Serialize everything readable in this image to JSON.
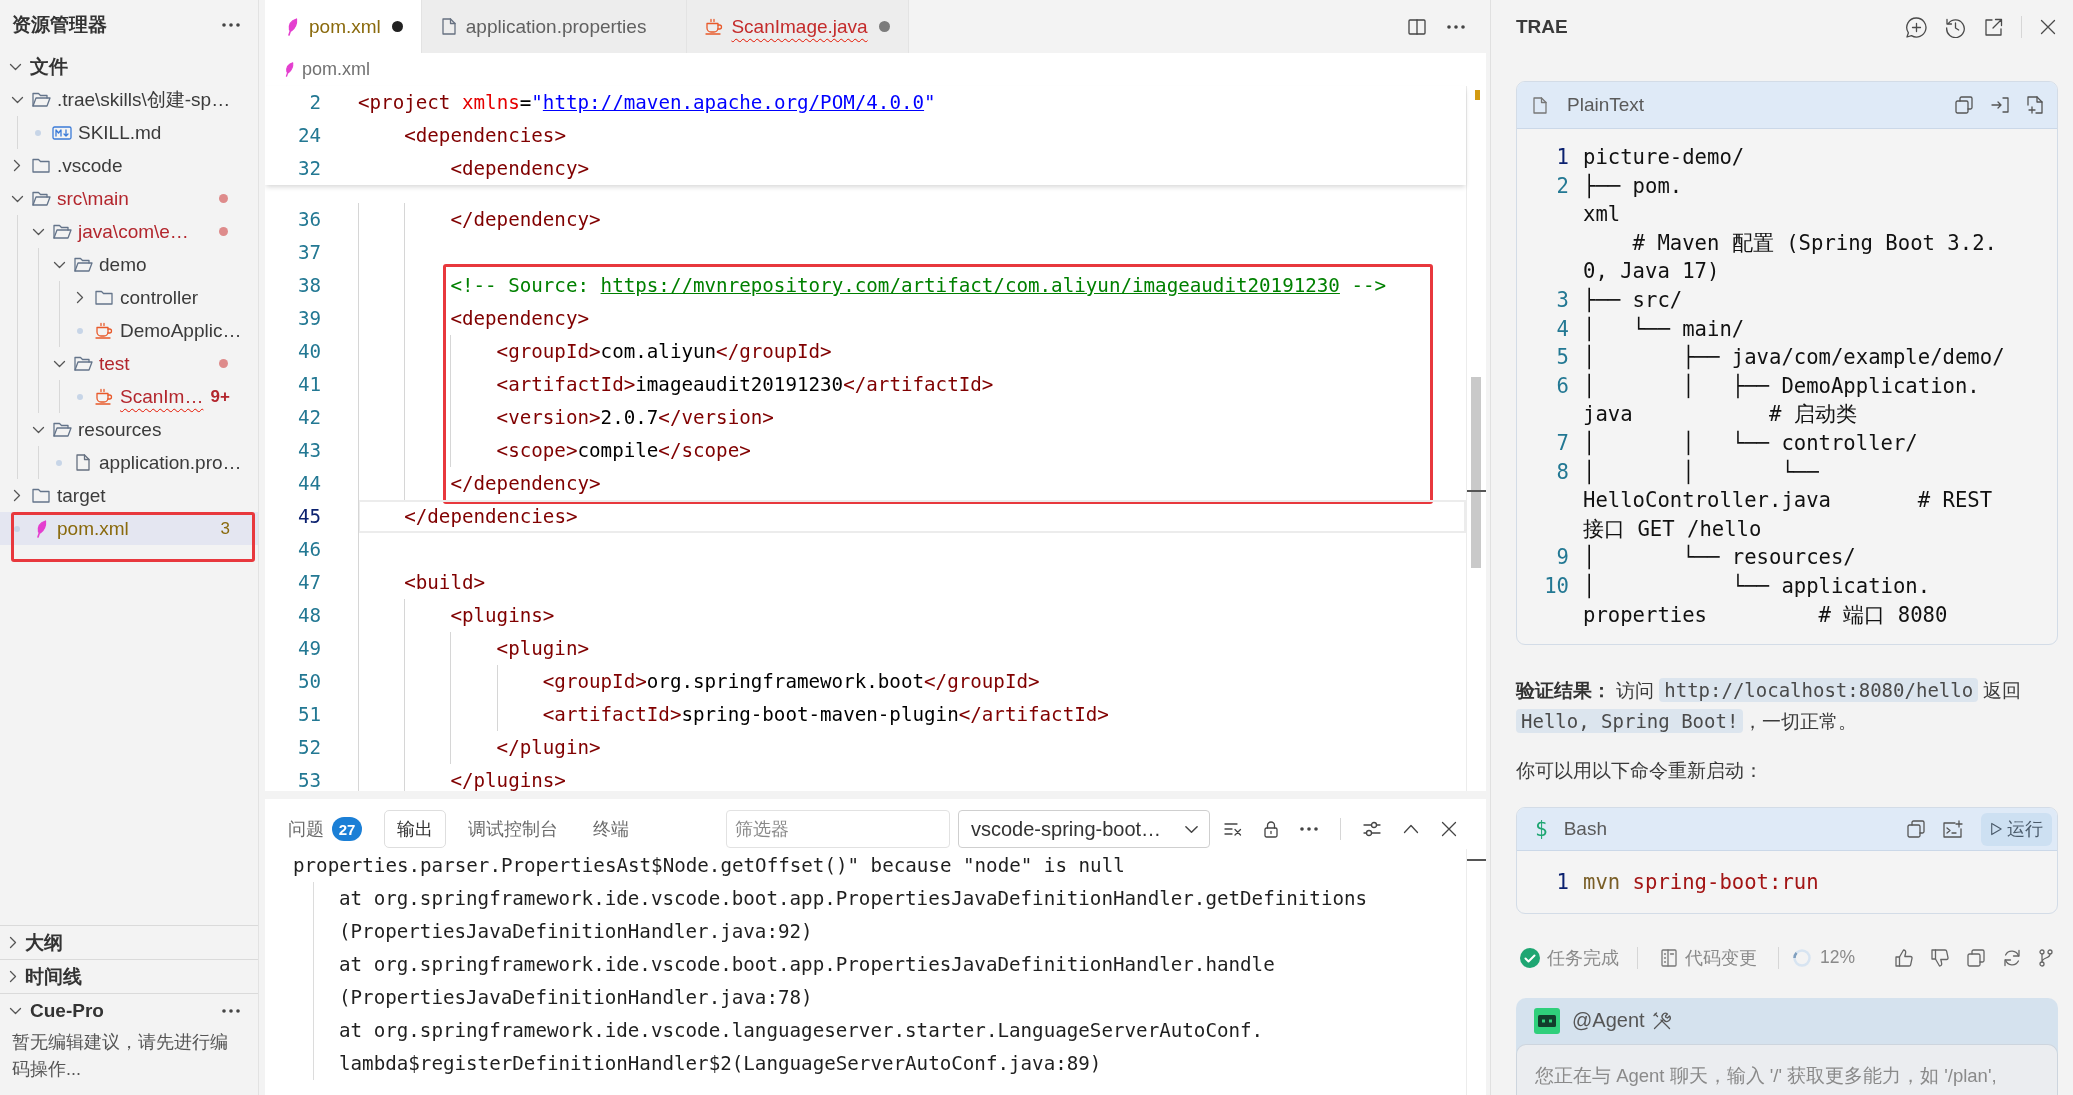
{
  "sidebar": {
    "title": "资源管理器",
    "files": {
      "title": "文件",
      "expanded": true,
      "items": [
        {
          "kind": "folder",
          "label": ".trae\\skills\\创建-sp…",
          "expanded": true,
          "selected": false,
          "errors": false,
          "warnings": false,
          "children": [
            {
              "kind": "md",
              "label": "SKILL.md",
              "selected": false,
              "errors": false,
              "warnings": false
            }
          ]
        },
        {
          "kind": "folder",
          "label": ".vscode",
          "expanded": false,
          "selected": false,
          "errors": false,
          "warnings": false
        },
        {
          "kind": "folder",
          "label": "src\\main",
          "expanded": true,
          "selected": false,
          "errors": true,
          "children": [
            {
              "kind": "folder",
              "label": "java\\com\\e…",
              "expanded": true,
              "selected": false,
              "errors": true,
              "children": [
                {
                  "kind": "folder",
                  "label": "demo",
                  "expanded": true,
                  "selected": false,
                  "errors": false,
                  "warnings": false,
                  "children": [
                    {
                      "kind": "folder",
                      "label": "controller",
                      "expanded": false,
                      "selected": false,
                      "errors": false,
                      "warnings": false
                    },
                    {
                      "kind": "java",
                      "label": "DemoApplic…",
                      "selected": false,
                      "errors": false,
                      "warnings": false
                    }
                  ]
                },
                {
                  "kind": "folder",
                  "label": "test",
                  "expanded": true,
                  "selected": false,
                  "errors": true,
                  "children": [
                    {
                      "kind": "java",
                      "label": "ScanIm…",
                      "selected": false,
                      "errors": true,
                      "badge": "9+"
                    }
                  ]
                }
              ]
            },
            {
              "kind": "folder",
              "label": "resources",
              "expanded": true,
              "selected": false,
              "errors": false,
              "warnings": false,
              "children": [
                {
                  "kind": "file",
                  "label": "application.pro…",
                  "selected": false,
                  "errors": false,
                  "warnings": false
                }
              ]
            }
          ]
        },
        {
          "kind": "folder",
          "label": "target",
          "expanded": false,
          "selected": false,
          "errors": false,
          "warnings": false
        },
        {
          "kind": "xml",
          "label": "pom.xml",
          "selected": true,
          "errors": false,
          "warnings": true,
          "badge": "3",
          "framed": true
        }
      ]
    },
    "sections": [
      {
        "title": "大纲",
        "expanded": false
      },
      {
        "title": "时间线",
        "expanded": false
      },
      {
        "title": "Cue-Pro",
        "expanded": true,
        "text": "暂无编辑建议，请先进行编码操作..."
      }
    ]
  },
  "editor": {
    "tabs": [
      {
        "kind": "xml",
        "label": "pom.xml",
        "selected": true,
        "errors": false,
        "warnings": true,
        "dirty": true
      },
      {
        "kind": "file",
        "label": "application.properties",
        "selected": false,
        "errors": false,
        "warnings": false,
        "dirty": false
      },
      {
        "kind": "java",
        "label": "ScanImage.java",
        "selected": false,
        "errors": true,
        "dirty": true
      }
    ],
    "breadcrumb": {
      "kind": "xml",
      "label": "pom.xml"
    },
    "sticky_lines": [
      {
        "number": "2",
        "tokens": [
          {
            "kind": "tag",
            "text": "<project"
          },
          {
            "kind": "attr",
            "text": " xmlns"
          },
          {
            "kind": "plain",
            "text": "="
          },
          {
            "kind": "string",
            "text": "\""
          },
          {
            "kind": "link",
            "text": "http://maven.apache.org/POM/4.0.0"
          },
          {
            "kind": "string",
            "text": "\""
          }
        ]
      },
      {
        "number": "24",
        "tokens": [
          {
            "kind": "tag",
            "text": "    <dependencies>"
          }
        ]
      },
      {
        "number": "32",
        "tokens": [
          {
            "kind": "tag",
            "text": "        <dependency>"
          }
        ]
      }
    ],
    "blocks": [
      {
        "framed": false,
        "lines": [
          {
            "number": "36",
            "current": false,
            "tokens": [
              {
                "kind": "tag",
                "text": "        </dependency>"
              }
            ]
          },
          {
            "number": "37",
            "current": false
          }
        ]
      },
      {
        "framed": true,
        "lines": [
          {
            "number": "38",
            "current": false,
            "tokens": [
              {
                "kind": "comment",
                "text": "        <!-- Source: "
              },
              {
                "kind": "comment_link",
                "text": "https://mvnrepository.com/artifact/com.aliyun/imageaudit20191230"
              },
              {
                "kind": "comment",
                "text": " -->"
              }
            ]
          },
          {
            "number": "39",
            "current": false,
            "tokens": [
              {
                "kind": "tag",
                "text": "        <dependency>"
              }
            ]
          },
          {
            "number": "40",
            "current": false,
            "tokens": [
              {
                "kind": "tag",
                "text": "            <groupId>"
              },
              {
                "kind": "text",
                "text": "com.aliyun"
              },
              {
                "kind": "tag",
                "text": "</groupId>"
              }
            ]
          },
          {
            "number": "41",
            "current": false,
            "tokens": [
              {
                "kind": "tag",
                "text": "            <artifactId>"
              },
              {
                "kind": "text",
                "text": "imageaudit20191230"
              },
              {
                "kind": "tag",
                "text": "</artifactId>"
              }
            ]
          },
          {
            "number": "42",
            "current": false,
            "tokens": [
              {
                "kind": "tag",
                "text": "            <version>"
              },
              {
                "kind": "text",
                "text": "2.0.7"
              },
              {
                "kind": "tag",
                "text": "</version>"
              }
            ]
          },
          {
            "number": "43",
            "current": false,
            "tokens": [
              {
                "kind": "tag",
                "text": "            <scope>"
              },
              {
                "kind": "text",
                "text": "compile"
              },
              {
                "kind": "tag",
                "text": "</scope>"
              }
            ]
          },
          {
            "number": "44",
            "current": false,
            "tokens": [
              {
                "kind": "tag",
                "text": "        </dependency>"
              }
            ]
          }
        ]
      },
      {
        "framed": false,
        "lines": [
          {
            "number": "45",
            "current": true,
            "tokens": [
              {
                "kind": "tag",
                "text": "    </dependencies>"
              }
            ]
          },
          {
            "number": "46",
            "current": false
          },
          {
            "number": "47",
            "current": false,
            "tokens": [
              {
                "kind": "tag",
                "text": "    <build>"
              }
            ]
          },
          {
            "number": "48",
            "current": false,
            "tokens": [
              {
                "kind": "tag",
                "text": "        <plugins>"
              }
            ]
          },
          {
            "number": "49",
            "current": false,
            "tokens": [
              {
                "kind": "tag",
                "text": "            <plugin>"
              }
            ]
          },
          {
            "number": "50",
            "current": false,
            "tokens": [
              {
                "kind": "tag",
                "text": "                <groupId>"
              },
              {
                "kind": "text",
                "text": "org.springframework.boot"
              },
              {
                "kind": "tag",
                "text": "</groupId>"
              }
            ]
          },
          {
            "number": "51",
            "current": false,
            "tokens": [
              {
                "kind": "tag",
                "text": "                <artifactId>"
              },
              {
                "kind": "text",
                "text": "spring-boot-maven-plugin"
              },
              {
                "kind": "tag",
                "text": "</artifactId>"
              }
            ]
          },
          {
            "number": "52",
            "current": false,
            "tokens": [
              {
                "kind": "tag",
                "text": "            </plugin>"
              }
            ]
          },
          {
            "number": "53",
            "current": false,
            "tokens": [
              {
                "kind": "tag",
                "text": "        </plugins>"
              }
            ]
          }
        ]
      }
    ]
  },
  "panel": {
    "tabs": [
      {
        "label": "问题",
        "badge": "27",
        "selected": false
      },
      {
        "label": "输出",
        "selected": true
      },
      {
        "label": "调试控制台",
        "selected": false
      },
      {
        "label": "终端",
        "selected": false
      }
    ],
    "filter": {
      "placeholder": "筛选器"
    },
    "channel": "vscode-spring-boot…",
    "output": [
      "properties.parser.PropertiesAst$Node.getOffset()\" because \"node\" is null",
      "    at org.springframework.ide.vscode.boot.app.PropertiesJavaDefinitionHandler.getDefinitions",
      "    (PropertiesJavaDefinitionHandler.java:92)",
      "    at org.springframework.ide.vscode.boot.app.PropertiesJavaDefinitionHandler.handle",
      "    (PropertiesJavaDefinitionHandler.java:78)",
      "    at org.springframework.ide.vscode.languageserver.starter.LanguageServerAutoConf.",
      "    lambda$registerDefinitionHandler$2(LanguageServerAutoConf.java:89)"
    ]
  },
  "assistant": {
    "title": "TRAE",
    "message": [
      {
        "kind": "code",
        "language": "PlainText",
        "lines": [
          {
            "number": "1",
            "current": true,
            "rows": [
              "picture-demo/"
            ]
          },
          {
            "number": "2",
            "current": false,
            "rows": [
              "├── pom.",
              "xml",
              "    # Maven 配置 (Spring Boot 3.2.",
              "0, Java 17)"
            ]
          },
          {
            "number": "3",
            "current": false,
            "rows": [
              "├── src/"
            ]
          },
          {
            "number": "4",
            "current": false,
            "rows": [
              "│   └── main/"
            ]
          },
          {
            "number": "5",
            "current": false,
            "rows": [
              "│       ├── java/com/example/demo/"
            ]
          },
          {
            "number": "6",
            "current": false,
            "rows": [
              "│       │   ├── DemoApplication.",
              "java           # 启动类"
            ]
          },
          {
            "number": "7",
            "current": false,
            "rows": [
              "│       │   └── controller/"
            ]
          },
          {
            "number": "8",
            "current": false,
            "rows": [
              "│       │       └──",
              "HelloController.java       # REST",
              "接口 GET /hello"
            ]
          },
          {
            "number": "9",
            "current": false,
            "rows": [
              "│       └── resources/"
            ]
          },
          {
            "number": "10",
            "current": false,
            "rows": [
              "│           └── application.",
              "properties         # 端口 8080"
            ]
          }
        ]
      },
      {
        "kind": "paragraph",
        "parts": [
          {
            "kind": "bold",
            "text": "验证结果："
          },
          {
            "kind": "text",
            "text": " 访问 "
          },
          {
            "kind": "code",
            "text": "http://localhost:8080/hello"
          },
          {
            "kind": "text",
            "text": " 返回 "
          },
          {
            "kind": "code",
            "text": "Hello, Spring Boot!"
          },
          {
            "kind": "text",
            "text": "，一切正常。"
          }
        ]
      },
      {
        "kind": "paragraph",
        "parts": [
          {
            "kind": "text",
            "text": "你可以用以下命令重新启动："
          }
        ]
      },
      {
        "kind": "command",
        "language": "Bash",
        "prompt": "$",
        "run_label": "运行",
        "lines": [
          {
            "number": "1",
            "current": true,
            "tokens": [
              {
                "kind": "command",
                "text": "mvn "
              },
              {
                "kind": "argument",
                "text": "spring-boot:run"
              }
            ]
          }
        ]
      }
    ],
    "status": {
      "done_label": "任务完成",
      "changes_label": "代码变更",
      "progress": {
        "level": 0.12,
        "label": "12%"
      }
    },
    "input": {
      "mention": "@Agent",
      "placeholder": "您正在与 Agent 聊天，输入 '/' 获取更多能力，如 '/plan',"
    }
  }
}
